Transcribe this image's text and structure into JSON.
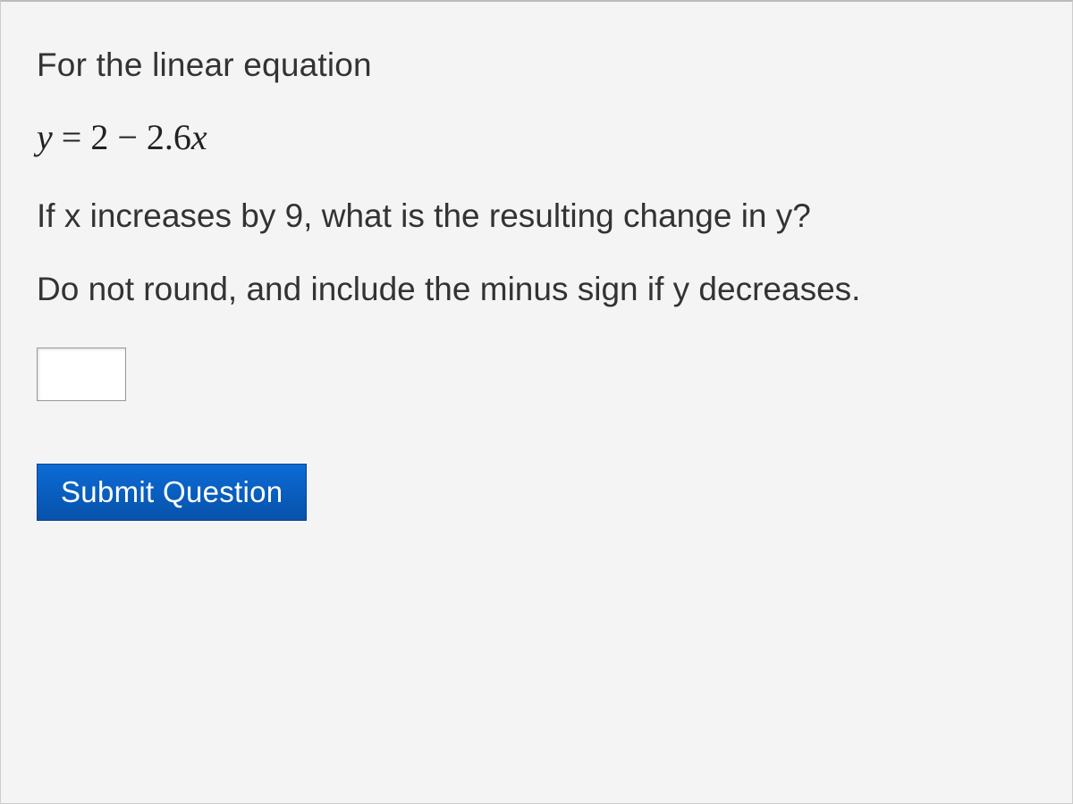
{
  "prompt": {
    "intro": "For the linear equation",
    "equation_y": "y",
    "equation_eq": " = 2 − 2.6",
    "equation_x": "x",
    "question": "If x increases by 9, what is the resulting change in y?",
    "instruction": "Do not round, and include the minus sign if y decreases."
  },
  "input": {
    "value": "",
    "placeholder": ""
  },
  "buttons": {
    "submit": "Submit Question"
  }
}
